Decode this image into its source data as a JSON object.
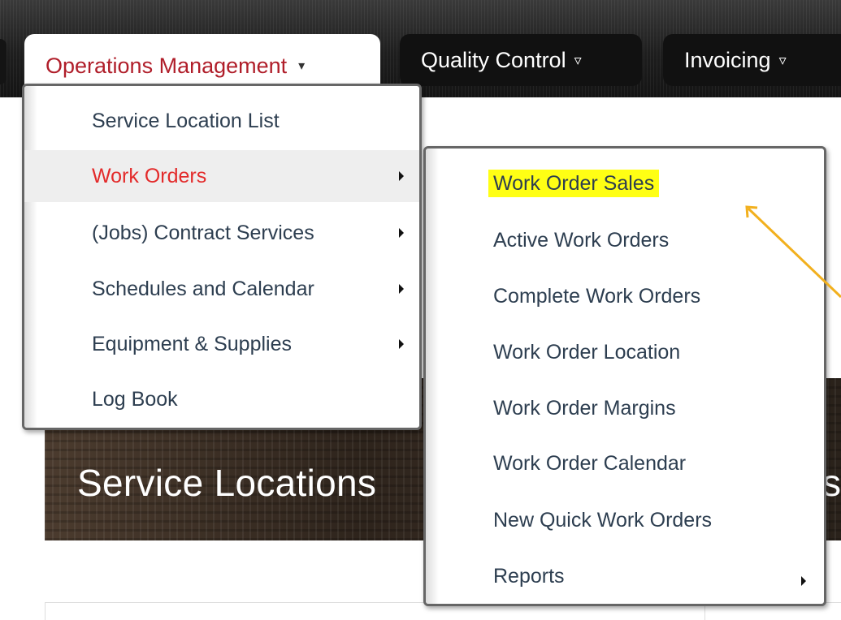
{
  "nav": {
    "tabs": [
      {
        "label": "Operations Management",
        "caret": "▾",
        "active": true
      },
      {
        "label": "Quality Control",
        "caret": "▿",
        "active": false
      },
      {
        "label": "Invoicing",
        "caret": "▿",
        "active": false
      }
    ]
  },
  "menu": {
    "items": [
      {
        "label": "Service Location List",
        "has_submenu": false
      },
      {
        "label": "Work Orders",
        "has_submenu": true,
        "hovered": true
      },
      {
        "label": "(Jobs) Contract Services",
        "has_submenu": true
      },
      {
        "label": "Schedules and Calendar",
        "has_submenu": true
      },
      {
        "label": "Equipment & Supplies",
        "has_submenu": true
      },
      {
        "label": "Log Book",
        "has_submenu": false
      }
    ]
  },
  "submenu": {
    "items": [
      {
        "label": "Work Order Sales",
        "highlighted": true
      },
      {
        "label": "Active Work Orders"
      },
      {
        "label": "Complete Work Orders"
      },
      {
        "label": "Work Order Location"
      },
      {
        "label": "Work Order Margins"
      },
      {
        "label": "Work Order Calendar"
      },
      {
        "label": "New Quick Work Orders"
      },
      {
        "label": "Reports",
        "has_submenu": true
      }
    ]
  },
  "page": {
    "hero_title": "Service Locations",
    "hero_right_fragment": "s"
  },
  "colors": {
    "active_tab_text": "#b01e2a",
    "hover_text": "#e32a2a",
    "menu_text": "#2d3e50",
    "highlight": "#ffff14",
    "annotation_arrow": "#f2b01e"
  },
  "icons": {
    "submenu_indicator": "caret-right-icon",
    "dropdown_indicator": "caret-down-icon"
  }
}
